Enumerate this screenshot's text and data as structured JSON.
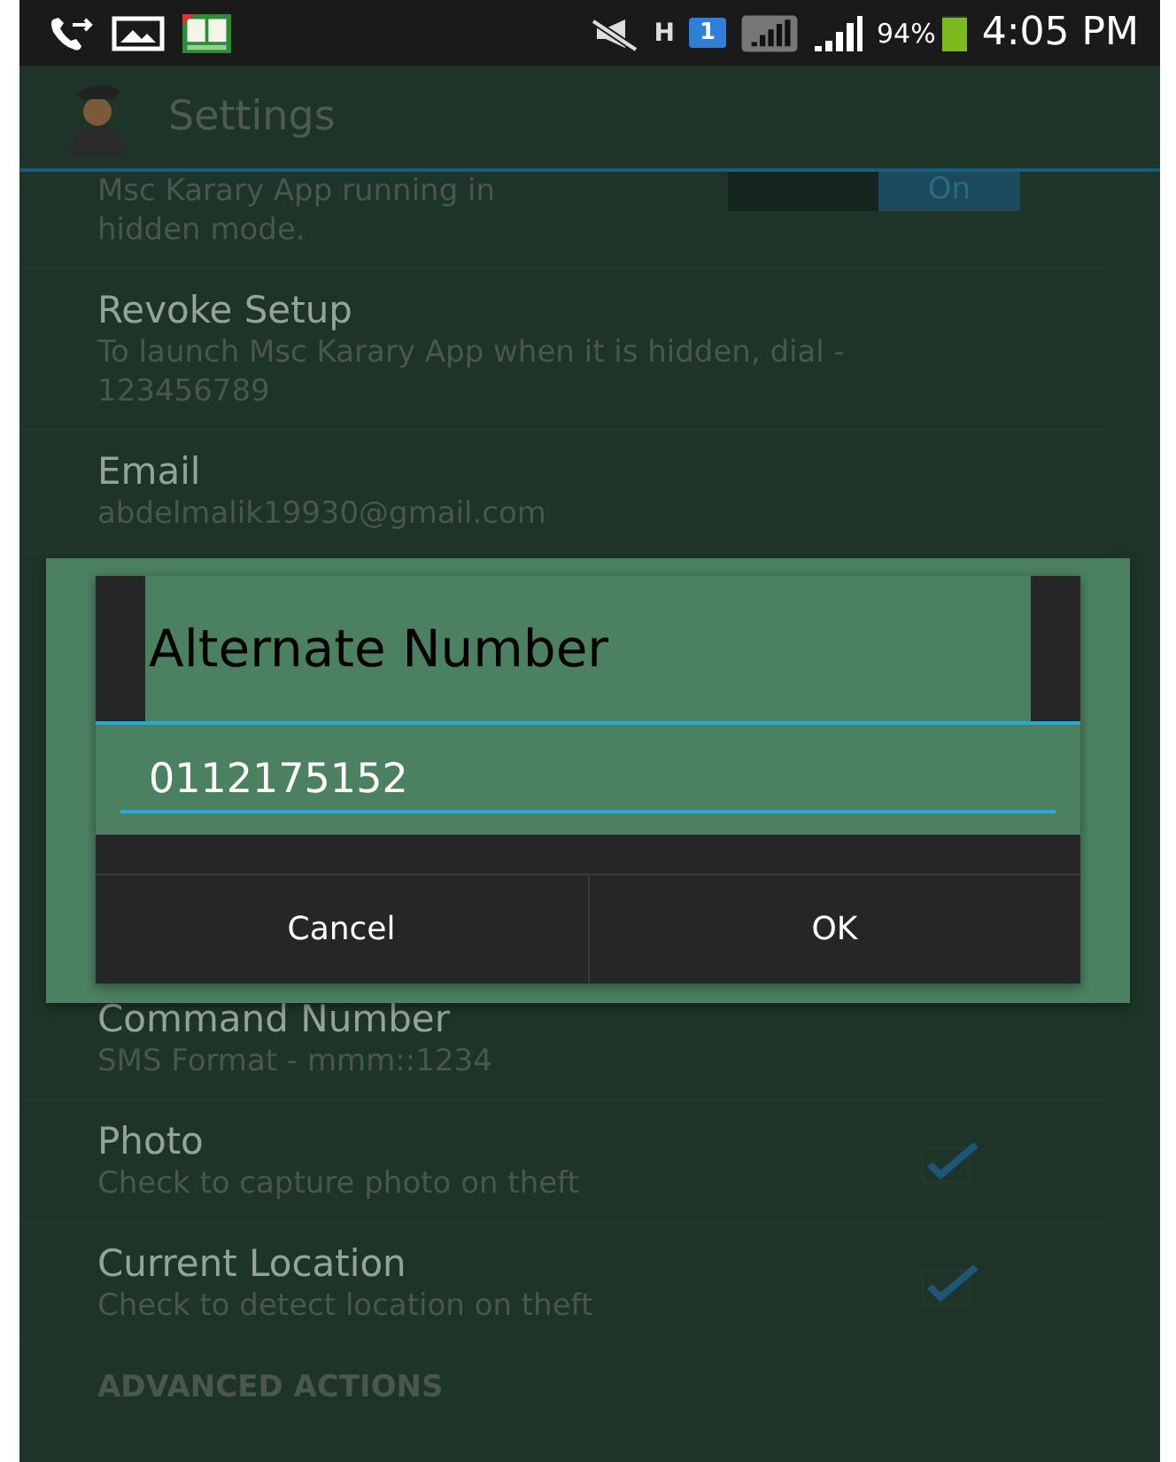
{
  "status_bar": {
    "data_label": "H",
    "sim_badge": "1",
    "battery_percent": "94%",
    "time": "4:05 PM"
  },
  "app_bar": {
    "title": "Settings"
  },
  "settings_above": [
    {
      "kind": "toggle",
      "subtitle": "Msc Karary App running in hidden mode.",
      "toggle_label": "On",
      "on": true
    },
    {
      "kind": "text",
      "title": "Revoke Setup",
      "subtitle": "To launch Msc Karary App when it is hidden, dial - 123456789"
    },
    {
      "kind": "text",
      "title": "Email",
      "subtitle": "abdelmalik19930@gmail.com"
    }
  ],
  "dialog": {
    "title": "Alternate Number",
    "value": "0112175152",
    "buttons": [
      "Cancel",
      "OK"
    ]
  },
  "settings_below": [
    {
      "kind": "text",
      "title": "Command Number",
      "subtitle": "SMS Format - mmm::1234"
    },
    {
      "kind": "checkbox",
      "title": "Photo",
      "subtitle": "Check to capture photo on theft",
      "checked": true
    },
    {
      "kind": "checkbox",
      "title": "Current Location",
      "subtitle": "Check to detect location on theft",
      "checked": true
    },
    {
      "kind": "header",
      "title": "ADVANCED ACTIONS"
    }
  ]
}
